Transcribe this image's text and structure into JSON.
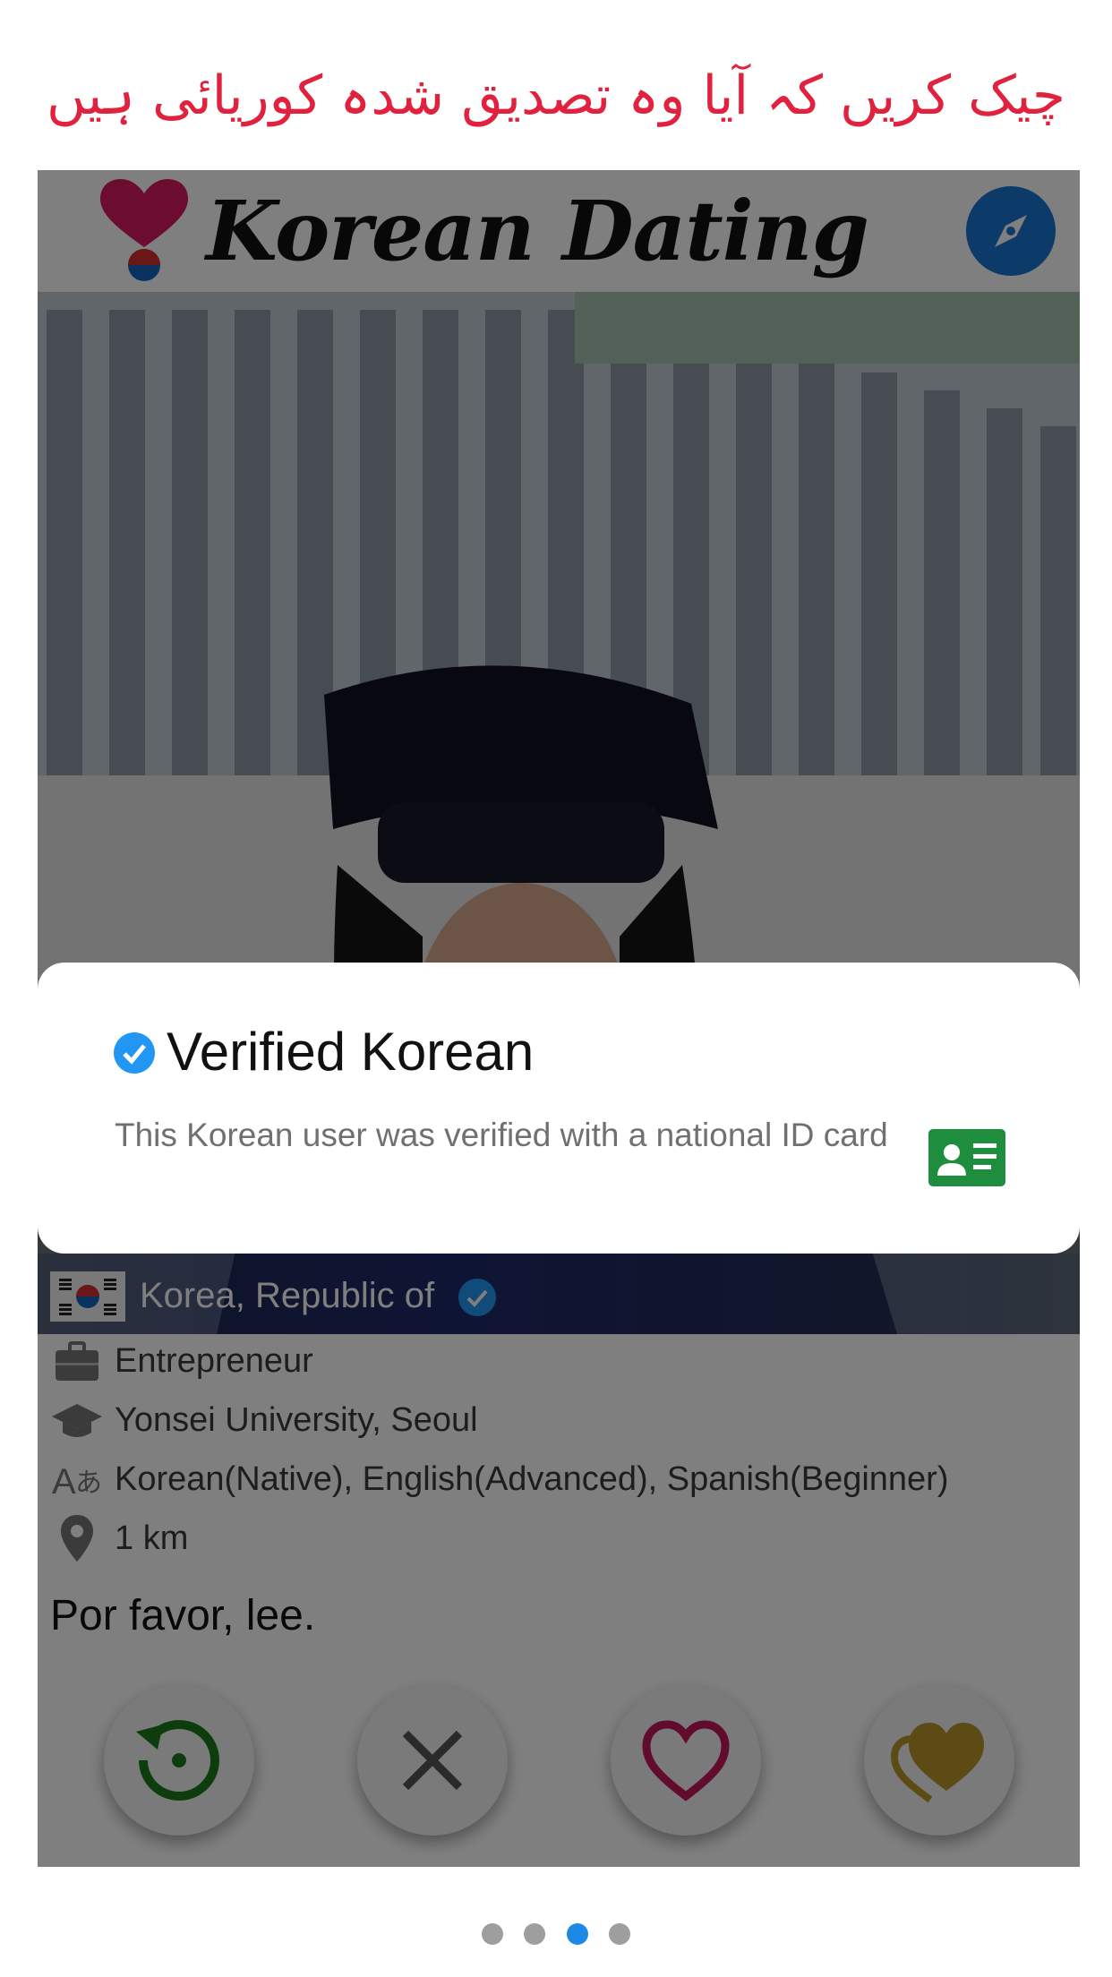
{
  "headline": "چیک کریں کہ آیا وہ تصدیق شدہ کوریائی ہیں",
  "app": {
    "title": "Korean Dating"
  },
  "profile": {
    "country": "Korea, Republic of",
    "occupation": "Entrepreneur",
    "education": "Yonsei University, Seoul",
    "languages": "Korean(Native), English(Advanced), Spanish(Beginner)",
    "distance": "1 km",
    "bio": "Por favor, lee."
  },
  "verified_sheet": {
    "title": "Verified Korean",
    "description": "This Korean user was verified with a national ID card"
  },
  "actions": [
    "rewind-button",
    "pass-button",
    "like-button",
    "super-like-button"
  ],
  "pager": {
    "count": 4,
    "active_index": 2
  },
  "colors": {
    "headline": "#e0223f",
    "accent_blue": "#1976d2",
    "verified_blue": "#2196f3",
    "rewind_green": "#1a7a1a",
    "like_red": "#c2185b",
    "super_like_gold": "#b8962a",
    "id_card_green": "#1e8e3e"
  }
}
